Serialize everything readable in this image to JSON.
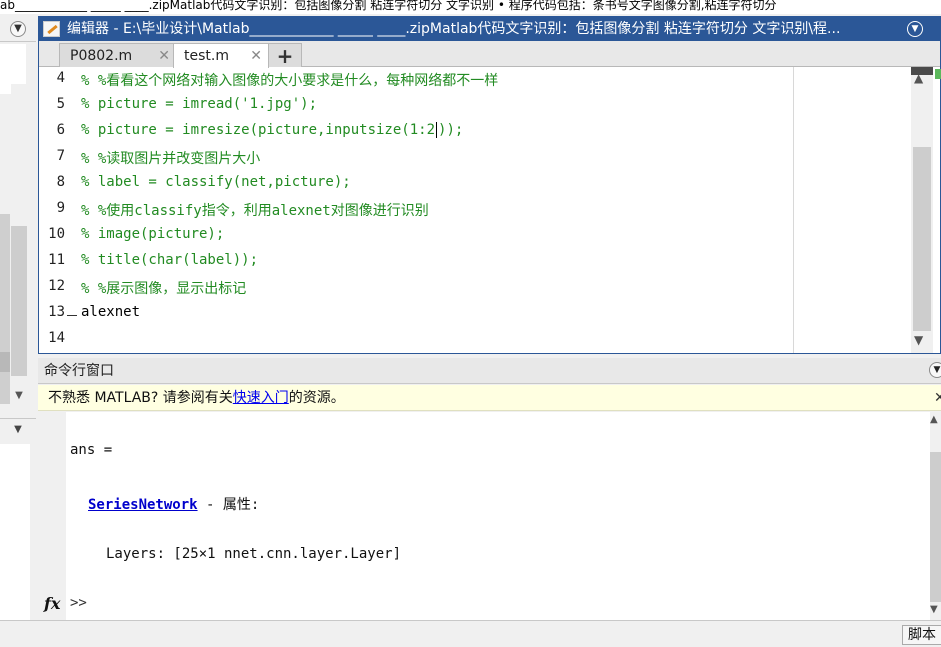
{
  "top_strip": {
    "text": "ab____________ _____ ____.zipMatlab代码文字识别：包括图像分割 粘连字符切分 文字识别 • 程序代码包括：条书号文字图像分割,粘连字符切分"
  },
  "editor": {
    "title": "编辑器 - E:\\毕业设计\\Matlab____________ _____ ____.zipMatlab代码文字识别：包括图像分割 粘连字符切分 文字识别\\程...",
    "tabs": [
      {
        "label": "P0802.m"
      },
      {
        "label": "test.m"
      }
    ],
    "add_tab_label": "+",
    "close_glyph": "✕",
    "lines": [
      {
        "num": "4",
        "text": "% %看看这个网络对输入图像的大小要求是什么，每种网络都不一样",
        "comment": true
      },
      {
        "num": "5",
        "text": "% picture = imread('1.jpg');",
        "comment": true
      },
      {
        "num": "6",
        "text_before_cursor": "% picture = imresize(picture,inputsize(1:2",
        "text_after_cursor": "));",
        "comment": true
      },
      {
        "num": "7",
        "text": "% %读取图片并改变图片大小",
        "comment": true
      },
      {
        "num": "8",
        "text": "% label = classify(net,picture);",
        "comment": true
      },
      {
        "num": "9",
        "text": "% %使用classify指令，利用alexnet对图像进行识别",
        "comment": true
      },
      {
        "num": "10",
        "text": "% image(picture);",
        "comment": true
      },
      {
        "num": "11",
        "text": "% title(char(label));",
        "comment": true
      },
      {
        "num": "12",
        "text": "% %展示图像，显示出标记",
        "comment": true
      },
      {
        "num": "13",
        "text": "alexnet",
        "comment": false,
        "dash": true
      },
      {
        "num": "14",
        "text": "",
        "comment": false
      }
    ]
  },
  "command_window": {
    "title": "命令行窗口",
    "notice": {
      "before": "不熟悉 MATLAB? 请参阅有关",
      "link": "快速入门",
      "after": "的资源。"
    },
    "output": {
      "ans_line": "ans =",
      "class_link": "SeriesNetwork",
      "class_suffix": " - 属性:",
      "layers_line": "Layers: [25×1 nnet.cnn.layer.Layer]"
    },
    "fx_label": "fx",
    "prompt": ">>"
  },
  "status_bar": {
    "script_label": "脚本"
  }
}
